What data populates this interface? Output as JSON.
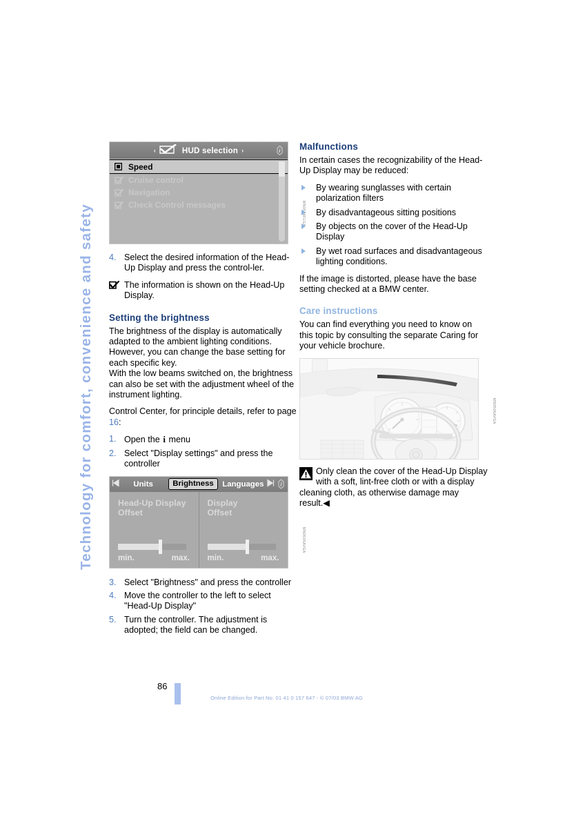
{
  "side_tab": {
    "label": "Technology for comfort, convenience and safety"
  },
  "hud_selection_screen": {
    "title": "HUD selection",
    "left_arrow": "‹",
    "right_arrow": "›",
    "checkbox_icon": "checkmark-box-icon",
    "info_icon": "info-icon",
    "items": [
      {
        "label": "Speed",
        "state": "selected",
        "box": "empty-box"
      },
      {
        "label": "Cruise control",
        "state": "dimmed",
        "box": "checked-box"
      },
      {
        "label": "Navigation",
        "state": "dimmed",
        "box": "checked-box"
      },
      {
        "label": "Check Control messages",
        "state": "dimmed",
        "box": "checked-box"
      }
    ],
    "figure_code": "MN0504FLGA"
  },
  "left_column": {
    "step4": {
      "num": "4.",
      "text": "Select the desired information of the Head-Up Display and press the control-ler."
    },
    "note": {
      "icon": "checkmark-box-icon",
      "text": "The information is shown on the Head-Up Display."
    },
    "heading_brightness": "Setting the brightness",
    "para1": "The brightness of the display is automatically adapted to the ambient lighting conditions. However, you can change the base setting for each specific key.",
    "para2": "With the low beams switched on, the brightness can also be set with the adjustment wheel of the instrument lighting.",
    "para3_pre": "Control Center, for principle details, refer to page ",
    "para3_page": "16",
    "para3_post": ":",
    "step1_num": "1.",
    "step1_pre": "Open the ",
    "step1_i": "i",
    "step1_post": " menu",
    "step2_num": "2.",
    "step2": "Select \"Display settings\" and press the controller",
    "step3_num": "3.",
    "step3": "Select \"Brightness\" and press the controller",
    "step5_num": "4.",
    "step5": "Move the controller to the left to select \"Head-Up Display\"",
    "step6_num": "5.",
    "step6": "Turn the controller. The adjustment is adopted; the field can be changed."
  },
  "brightness_screen": {
    "prev_icon": "left-arrow-icon",
    "next_icon": "right-arrow-icon",
    "info_icon": "info-icon",
    "tabs": [
      {
        "label": "Units",
        "active": false
      },
      {
        "label": "Brightness",
        "active": true
      },
      {
        "label": "Languages",
        "active": false
      }
    ],
    "cells": [
      {
        "title": "Head-Up Display\nOffset",
        "min_label": "min.",
        "max_label": "max.",
        "value_pct": 62
      },
      {
        "title": "Display\nOffset",
        "min_label": "min.",
        "max_label": "max.",
        "value_pct": 58
      }
    ],
    "figure_code": "MN0505AVGA"
  },
  "right_column": {
    "heading_malfunctions": "Malfunctions",
    "intro": "In certain cases the recognizability of the Head-Up Display may be reduced:",
    "bullets": [
      "By wearing sunglasses with certain polarization filters",
      "By disadvantageous sitting positions",
      "By objects on the cover of the Head-Up Display",
      "By wet road surfaces and disadvantageous lighting conditions."
    ],
    "distorted": "If the image is distorted, please have the base setting checked at a BMW center.",
    "heading_care": "Care instructions",
    "care_text": "You can find everything you need to know on this topic by consulting the separate Caring for your vehicle brochure.",
    "figure": {
      "name": "dashboard-head-up-display-illustration",
      "figure_code": "MN0506AVGA"
    },
    "warning": {
      "icon": "warning-triangle-icon",
      "text": "Only clean the cover of the Head-Up Display with a soft, lint-free cloth or with a display cleaning cloth, as otherwise damage may result.",
      "end_mark": "◀"
    }
  },
  "footer": {
    "page_number": "86",
    "imprint": "Online Edition for Part No. 01 41 0 157 647 - © 07/03 BMW AG"
  },
  "colors": {
    "heading_dark_blue": "#1d3f7a",
    "heading_light_blue": "#8fb4e0",
    "side_tab_blue": "#9ab4e8",
    "list_number_blue": "#4f7dc0",
    "page_bar_blue": "#a9c0ee",
    "footer_blue": "#8fa7d8"
  }
}
